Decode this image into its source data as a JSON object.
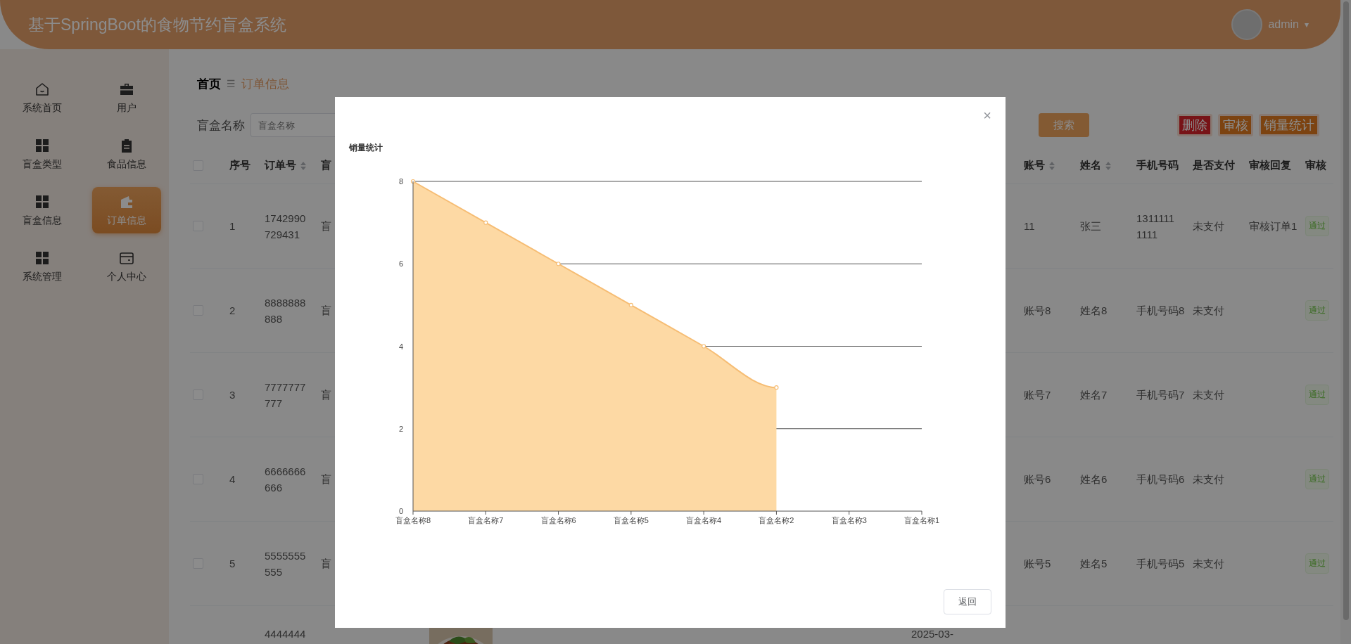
{
  "header": {
    "title": "基于SpringBoot的食物节约盲盒系统",
    "user": "admin",
    "caret": "▾"
  },
  "sidebar": {
    "items": [
      {
        "label": "系统首页",
        "kind": "home",
        "selected": false
      },
      {
        "label": "用户",
        "kind": "briefcase",
        "selected": false
      },
      {
        "label": "盲盒类型",
        "kind": "grid",
        "selected": false
      },
      {
        "label": "食品信息",
        "kind": "clipboard",
        "selected": false
      },
      {
        "label": "盲盒信息",
        "kind": "grid",
        "selected": false
      },
      {
        "label": "订单信息",
        "kind": "wallet",
        "selected": true
      },
      {
        "label": "系统管理",
        "kind": "grid",
        "selected": false
      },
      {
        "label": "个人中心",
        "kind": "card",
        "selected": false
      }
    ]
  },
  "breadcrumb": {
    "home": "首页",
    "separator": "☰",
    "current": "订单信息"
  },
  "search": {
    "label": "盲盒名称",
    "placeholder": "盲盒名称",
    "button": "搜索"
  },
  "actions": [
    {
      "label": "删除",
      "kind": "danger"
    },
    {
      "label": "审核",
      "kind": "warning"
    },
    {
      "label": "销量统计",
      "kind": "warning"
    }
  ],
  "table": {
    "select_all": {
      "checked": false
    },
    "columns": [
      {
        "label": "序号",
        "sortable": false
      },
      {
        "label": "订单号",
        "sortable": true
      },
      {
        "label": "盲",
        "sortable": false
      },
      {
        "label": "账号",
        "sortable": true
      },
      {
        "label": "姓名",
        "sortable": true
      },
      {
        "label": "手机号码",
        "sortable": false
      },
      {
        "label": "是否支付",
        "sortable": false
      },
      {
        "label": "审核回复",
        "sortable": false
      },
      {
        "label": "审核",
        "sortable": false
      }
    ],
    "rows": [
      {
        "checked": false,
        "seq": "1",
        "order": "1742990\n729431",
        "box": "盲",
        "account": "11",
        "name": "张三",
        "phone": "1311111\n1111",
        "paid": "未支付",
        "reply": "审核订单1",
        "status": "通过"
      },
      {
        "checked": false,
        "seq": "2",
        "order": "8888888\n888",
        "box": "盲",
        "account": "账号8",
        "name": "姓名8",
        "phone": "手机号码8",
        "paid": "未支付",
        "status": "通过"
      },
      {
        "checked": false,
        "seq": "3",
        "order": "7777777\n777",
        "box": "盲",
        "account": "账号7",
        "name": "姓名7",
        "phone": "手机号码7",
        "paid": "未支付",
        "status": "通过"
      },
      {
        "checked": false,
        "seq": "4",
        "order": "6666666\n666",
        "box": "盲",
        "account": "账号6",
        "name": "姓名6",
        "phone": "手机号码6",
        "paid": "未支付",
        "status": "通过"
      },
      {
        "checked": false,
        "seq": "5",
        "order": "5555555\n555",
        "box": "盲",
        "account": "账号5",
        "name": "姓名5",
        "phone": "手机号码5",
        "paid": "未支付",
        "status": "通过"
      },
      {
        "order": "4444444",
        "date": "2025-03-"
      }
    ]
  },
  "modal": {
    "close": "×",
    "back_button": "返回",
    "chart_data": {
      "type": "area",
      "title": "销量统计",
      "categories": [
        "盲盒名称8",
        "盲盒名称7",
        "盲盒名称6",
        "盲盒名称5",
        "盲盒名称4",
        "盲盒名称2",
        "盲盒名称3",
        "盲盒名称1"
      ],
      "series": [
        {
          "color": "#fdd9a4",
          "values": [
            8,
            7,
            6,
            5,
            4,
            3,
            null,
            null
          ]
        }
      ],
      "ylim": [
        0,
        8
      ],
      "grid": true,
      "yticks": [
        {
          "value": 0,
          "label": "0"
        },
        {
          "value": 2,
          "label": "2"
        },
        {
          "value": 4,
          "label": "4"
        },
        {
          "value": 6,
          "label": "6"
        },
        {
          "value": 8,
          "label": "8"
        }
      ]
    }
  }
}
